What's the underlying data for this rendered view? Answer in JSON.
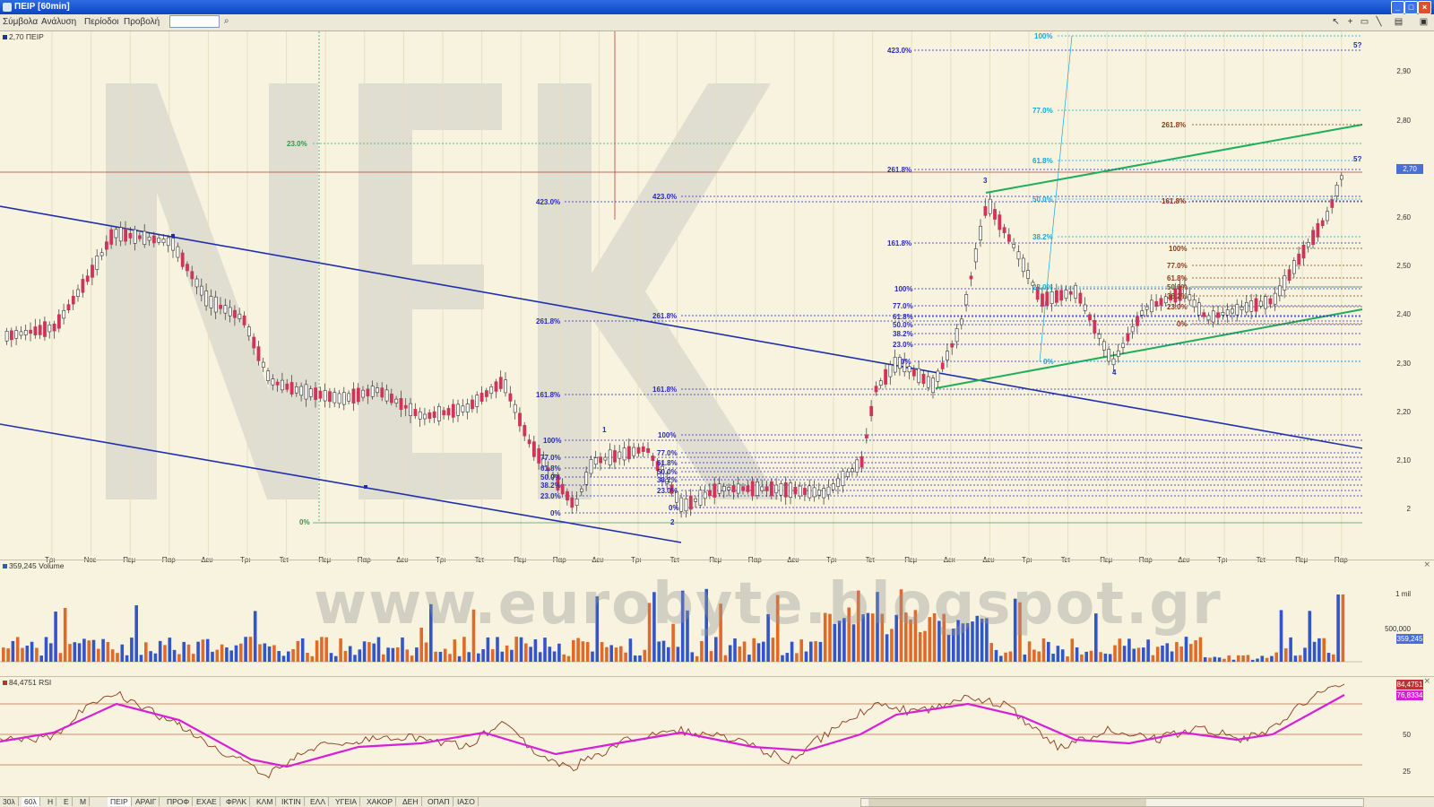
{
  "window": {
    "title": "ΠΕΙΡ [60min]",
    "controls": [
      "_",
      "□",
      "×"
    ]
  },
  "menu": {
    "items": [
      "Σύμβολα",
      "Ανάλυση",
      "Περίοδοι",
      "Προβολή"
    ],
    "symbol_value": "",
    "search_icon": "magnifier-icon",
    "tools": [
      "pointer-icon",
      "crosshair-icon",
      "rectangle-icon",
      "line-icon",
      "window-icon",
      "save-icon"
    ]
  },
  "price_panel": {
    "label": "2,70 ΠΕΙΡ",
    "last_price": "2,70",
    "y_axis": [
      "2,90",
      "2,80",
      "2,70",
      "2,60",
      "2,50",
      "2,40",
      "2,30",
      "2,20",
      "2,10",
      "2"
    ],
    "x_axis": [
      "Τρι",
      "Νοε",
      "Πεμ",
      "Παρ",
      "Δευ",
      "Τρι",
      "Τετ",
      "Πεμ",
      "Παρ",
      "Δευ",
      "Τρι",
      "Τετ",
      "Πεμ",
      "Παρ",
      "Δευ",
      "Τρι",
      "Τετ",
      "Πεμ",
      "Παρ",
      "Δευ",
      "Τρι",
      "Τετ",
      "Πεμ",
      "Δεκ",
      "Δευ",
      "Τρι",
      "Τετ",
      "Πεμ",
      "Παρ",
      "Δευ",
      "Τρι",
      "Τετ",
      "Πεμ",
      "Παρ"
    ],
    "wave_labels": [
      "1",
      "2",
      "3",
      "4",
      "5?",
      "5?"
    ],
    "fib_labels_blue": [
      "423.0%",
      "423.0%",
      "423.0%",
      "261.8%",
      "261.8%",
      "261.8%",
      "161.8%",
      "161.8%",
      "161.8%",
      "100%",
      "100%",
      "100%",
      "77.0%",
      "77.0%",
      "77.0%",
      "61.8%",
      "61.8%",
      "61.8%",
      "50.0%",
      "50.0%",
      "50.0%",
      "38.2%",
      "38.2%",
      "38.2%",
      "23.0%",
      "23.0%",
      "23.0%",
      "0%",
      "0%",
      "0%"
    ],
    "fib_labels_cyan": [
      "100%",
      "77.0%",
      "61.8%",
      "50.0%",
      "38.2%",
      "23.0%",
      "0%"
    ],
    "fib_labels_brown": [
      "261.8%",
      "161.8%",
      "100%",
      "77.0%",
      "61.8%",
      "50.0%",
      "38.2%",
      "23.0%",
      "0%"
    ],
    "fib_labels_green": [
      "23.0%",
      "0%"
    ],
    "watermark_letters": "NEK"
  },
  "volume_panel": {
    "label": "359,245 Volume",
    "y_axis": [
      "1 mil",
      "500,000"
    ],
    "last_value": "359,245",
    "watermark": "www.eurobyte.blogspot.gr"
  },
  "rsi_panel": {
    "label": "84,4751 RSI",
    "y_axis": [
      "50",
      "25"
    ],
    "rsi_value": "84,4751",
    "ma_value": "76,8334"
  },
  "tabs": {
    "periods": [
      "30λ",
      "60λ",
      "Η",
      "Ε",
      "Μ"
    ],
    "symbols": [
      "ΠΕΙΡ",
      "ΑΡΑΙΓ",
      "ΠΡΟΦ",
      "ΕΧΑΕ",
      "ΦΡΛΚ",
      "ΚΛΜ",
      "ΙΚΤΙΝ",
      "ΕΛΛ",
      "ΥΓΕΙΑ",
      "ΧΑΚΟΡ",
      "ΔΕΗ",
      "ΟΠΑΠ",
      "ΙΑΣΟ"
    ]
  },
  "colors": {
    "background": "#f7f3df",
    "up_candle": "#ffffff",
    "down_candle": "#d1335a",
    "channel_blue": "#1f2fb0",
    "trend_green": "#1fae5a",
    "fib_blue": "#2a2ab8",
    "fib_cyan": "#1aa6d8",
    "fib_brown": "#8a3a1a",
    "volume_blue": "#3355cc",
    "volume_orange": "#e06a2a",
    "rsi_line": "#8a3a1a",
    "rsi_ma": "#d81fd8"
  }
}
